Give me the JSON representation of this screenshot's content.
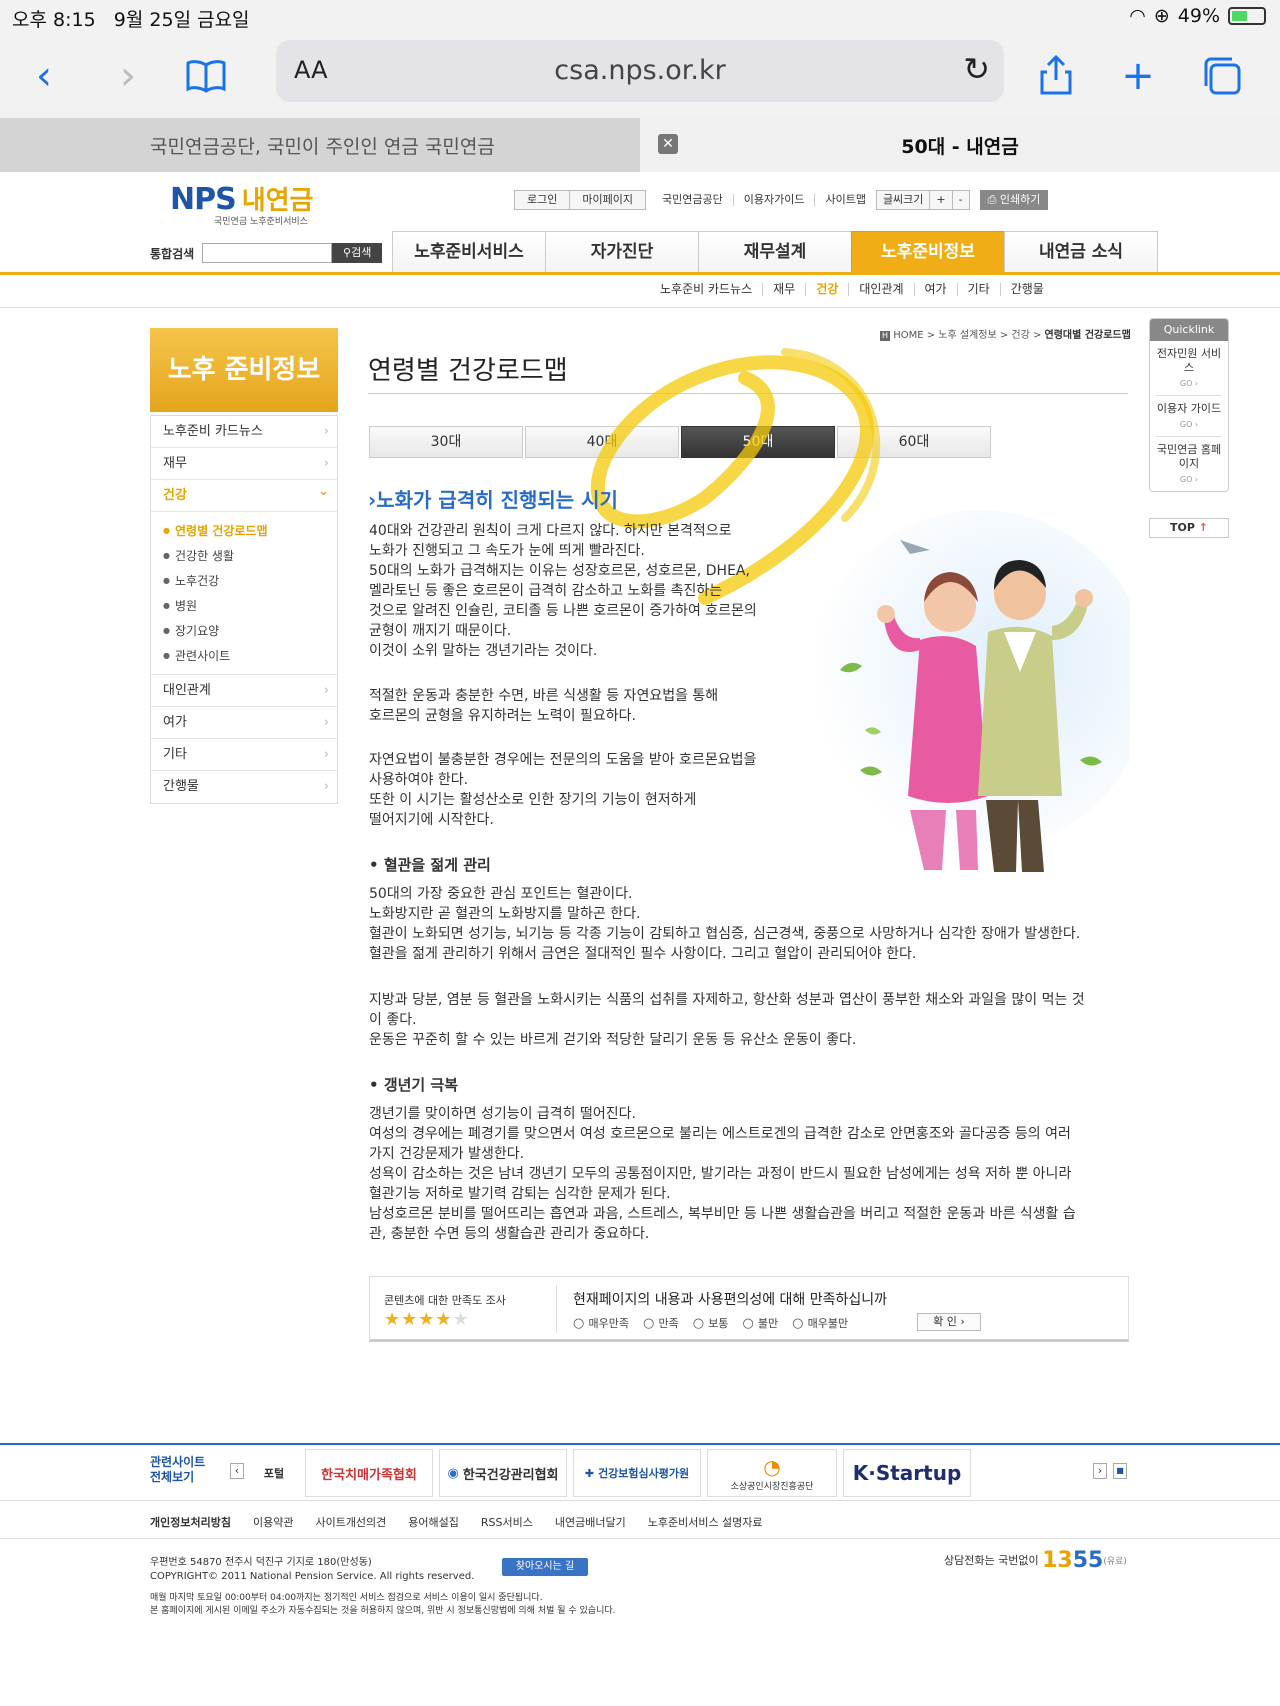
{
  "status": {
    "time": "오후 8:15",
    "date": "9월 25일 금요일",
    "battery": "49%",
    "battery_level": 0.49
  },
  "browser": {
    "text_size": "AA",
    "url": "csa.nps.or.kr"
  },
  "tabs": {
    "tab1": "국민연금공단, 국민이 주인인 연금 국민연금",
    "tab2": "50대 - 내연금",
    "close": "✕"
  },
  "logo": {
    "nps": "NPS",
    "kr": "내연금",
    "sub": "국민연금 노후준비서비스"
  },
  "util": {
    "login": "로그인",
    "mypage": "마이페이지",
    "nps": "국민연금공단",
    "guide": "이용자가이드",
    "sitemap": "사이트맵",
    "fontsize": "글씨크기",
    "plus": "+",
    "minus": "-",
    "print": "인쇄하기"
  },
  "search": {
    "label": "통합검색",
    "button": "검색"
  },
  "gnb": [
    "노후준비서비스",
    "자가진단",
    "재무설계",
    "노후준비정보",
    "내연금 소식"
  ],
  "subnav": [
    "노후준비 카드뉴스",
    "재무",
    "건강",
    "대인관계",
    "여가",
    "기타",
    "간행물"
  ],
  "lnb": {
    "title": "노후 준비정보",
    "items": [
      "노후준비 카드뉴스",
      "재무",
      "건강"
    ],
    "sub": [
      "연령별 건강로드맵",
      "건강한 생활",
      "노후건강",
      "병원",
      "장기요양",
      "관련사이트"
    ],
    "items2": [
      "대인관계",
      "여가",
      "기타",
      "간행물"
    ]
  },
  "breadcrumb": {
    "home": "HOME",
    "path": " > 노후 설계정보 > 건강 > ",
    "current": "연령대별 건강로드맵"
  },
  "page_title": "연령별 건강로드맵",
  "age_tabs": [
    "30대",
    "40대",
    "50대",
    "60대"
  ],
  "content": {
    "heading": "노화가 급격히 진행되는 시기",
    "p1": [
      "40대와 건강관리 원칙이 크게 다르지 않다. 하지만 본격적으로",
      "노화가 진행되고 그 속도가 눈에 띄게 빨라진다.",
      "50대의 노화가 급격해지는 이유는 성장호르몬, 성호르몬, DHEA,",
      "멜라토닌 등 좋은 호르몬이 급격히 감소하고 노화를 촉진하는",
      "것으로 알려진 인슐린, 코티졸 등 나쁜 호르몬이 증가하여 호르몬의",
      "균형이 깨지기 때문이다.",
      "이것이 소위 말하는 갱년기라는 것이다."
    ],
    "p2": [
      "적절한 운동과 충분한 수면, 바른 식생활 등 자연요법을 통해",
      "호르몬의 균형을 유지하려는 노력이 필요하다."
    ],
    "p3": [
      "자연요법이 불충분한 경우에는 전문의의 도움을 받아 호르몬요법을",
      "사용하여야 한다.",
      "또한 이 시기는 활성산소로 인한 장기의 기능이 현저하게",
      "떨어지기에 시작한다."
    ],
    "h2": "혈관을 젊게 관리",
    "p4": [
      "50대의 가장 중요한 관심 포인트는 혈관이다.",
      "노화방지란 곧 혈관의 노화방지를 말하곤 한다.",
      "혈관이 노화되면 성기능, 뇌기능 등 각종 기능이 감퇴하고 협심증, 심근경색, 중풍으로 사망하거나 심각한 장애가 발생한다.",
      "혈관을 젊게 관리하기 위해서 금연은 절대적인 필수 사항이다. 그리고 혈압이 관리되어야 한다."
    ],
    "p5": [
      "지방과 당분, 염분 등 혈관을 노화시키는 식품의 섭취를 자제하고, 항산화 성분과 엽산이 풍부한 채소와 과일을 많이 먹는 것",
      "이 좋다.",
      "운동은 꾸준히 할 수 있는 바르게 걷기와 적당한 달리기 운동 등 유산소 운동이 좋다."
    ],
    "h3": "갱년기 극복",
    "p6": [
      "갱년기를 맞이하면 성기능이 급격히 떨어진다.",
      "여성의 경우에는 폐경기를 맞으면서 여성 호르몬으로 불리는 에스트로겐의 급격한 감소로 안면홍조와 골다공증 등의 여러",
      "가지 건강문제가 발생한다.",
      "성욕이 감소하는 것은 남녀 갱년기 모두의 공통점이지만, 발기라는 과정이 반드시 필요한 남성에게는 성욕 저하 뿐 아니라",
      "혈관기능 저하로 발기력 감퇴는 심각한 문제가 된다.",
      "남성호르몬 분비를 떨어뜨리는 흡연과 과음, 스트레스, 복부비만 등 나쁜 생활습관을 버리고 적절한 운동과 바른 식생활 습",
      "관, 충분한 수면 등의 생활습관 관리가 중요하다."
    ]
  },
  "quicklink": {
    "title": "Quicklink",
    "items": [
      "전자민원 서비스",
      "이용자 가이드",
      "국민연금 홈페이지"
    ],
    "go": "GO ›",
    "top": "TOP"
  },
  "survey": {
    "label": "콘텐츠에 대한 만족도 조사",
    "rating": 4,
    "rating_max": 5,
    "question": "현재페이지의 내용과 사용편의성에 대해 만족하십니까",
    "options": [
      "매우만족",
      "만족",
      "보통",
      "불만",
      "매우불만"
    ],
    "confirm": "확 인 ›"
  },
  "footer": {
    "related_label": "관련사이트 전체보기",
    "banners": [
      "포털",
      "한국치매가족협회",
      "한국건강관리협회",
      "건강보험심사평가원",
      "소상공인시장진흥공단",
      "K·Startup"
    ],
    "links": [
      "개인정보처리방침",
      "이용약관",
      "사이트개선의견",
      "용어해설집",
      "RSS서비스",
      "내연금배너달기",
      "노후준비서비스 설명자료"
    ],
    "addr1": "우편번호 54870  전주시 덕진구 기지로 180(만성동)",
    "addr2": "COPYRIGHT© 2011 National Pension Service. All rights reserved.",
    "map": "찾아오시는 길",
    "notice1": "매월 마지막 토요일 00:00부터 04:00까지는 정기적인 서비스 점검으로 서비스 이용이 일시 중단됩니다.",
    "notice2": "본 홈페이지에 게시된 이메일 주소가 자동수집되는 것을 허용하지 않으며, 위반 시 정보통신망법에 의해 처벌 될 수 있습니다.",
    "phone_label": "상담전화는 국번없이 ",
    "phone_a": "13",
    "phone_b": "55",
    "phone_note": "(유료)"
  }
}
